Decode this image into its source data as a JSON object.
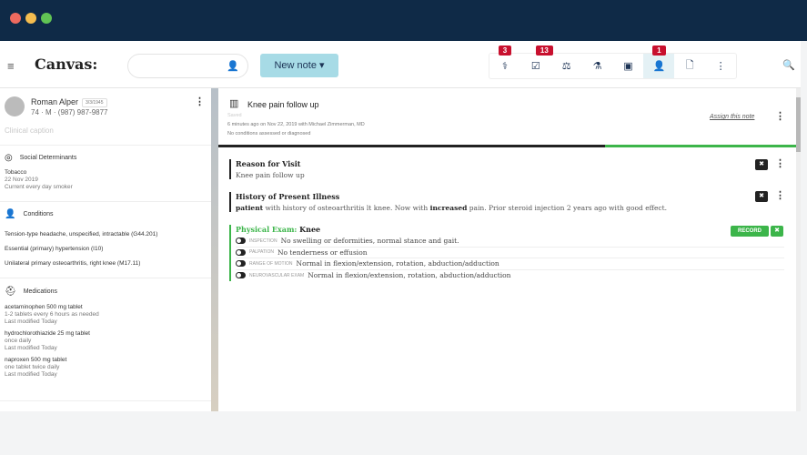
{
  "app": {
    "logo": "Canvas:",
    "new_note": "New note ▾",
    "menu_icon": "≡"
  },
  "toolbar": {
    "badges": [
      "3",
      "13",
      "1"
    ]
  },
  "patient": {
    "name": "Roman Alper",
    "dob": "3/3/1945",
    "info": "74 · M · (987) 987-9877",
    "caption": "Clinical caption"
  },
  "social": {
    "title": "Social Determinants",
    "item": "Tobacco",
    "date": "22 Nov 2019",
    "detail": "Current every day smoker"
  },
  "conditions": {
    "title": "Conditions",
    "items": [
      "Tension-type headache, unspecified, intractable (G44.201)",
      "Essential (primary) hypertension (I10)",
      "Unilateral primary osteoarthritis, right knee (M17.11)"
    ]
  },
  "medications": {
    "title": "Medications",
    "items": [
      {
        "name": "acetaminophen 500 mg tablet",
        "sig": "1-2 tablets every 6 hours as needed",
        "mod": "Last modified Today"
      },
      {
        "name": "hydrochlorothiazide 25 mg tablet",
        "sig": "once daily",
        "mod": "Last modified Today"
      },
      {
        "name": "naproxen 500 mg tablet",
        "sig": "one tablet twice daily",
        "mod": "Last modified Today"
      }
    ]
  },
  "note": {
    "title": "Knee pain follow up",
    "status": "Saved",
    "meta": "6 minutes ago on Nov 22, 2019 with Michael Zimmerman, MD",
    "conditions": "No conditions assessed or diagnosed",
    "assign": "Assign this note",
    "progress": 0.67
  },
  "rfv": {
    "title": "Reason for Visit",
    "body": "Knee pain follow up"
  },
  "hpi": {
    "title": "History of Present Illness",
    "b1": "patient",
    "t1": " with history of osteoarthritis lt knee.  Now with ",
    "b2": "increased",
    "t2": " pain.  Prior steroid injection 2 years ago with good effect."
  },
  "exam": {
    "label": "Physical Exam:",
    "part": "Knee",
    "record": "RECORD",
    "rows": [
      {
        "label": "INSPECTION",
        "text": "No swelling or deformities, normal stance and gait."
      },
      {
        "label": "PALPATION",
        "text": "No tenderness or effusion"
      },
      {
        "label": "RANGE OF MOTION",
        "text": "Normal in flexion/extension, rotation, abduction/adduction"
      },
      {
        "label": "NEUROVASCULAR EXAM",
        "text": "Normal in flexion/extension, rotation, abduction/adduction"
      }
    ]
  }
}
